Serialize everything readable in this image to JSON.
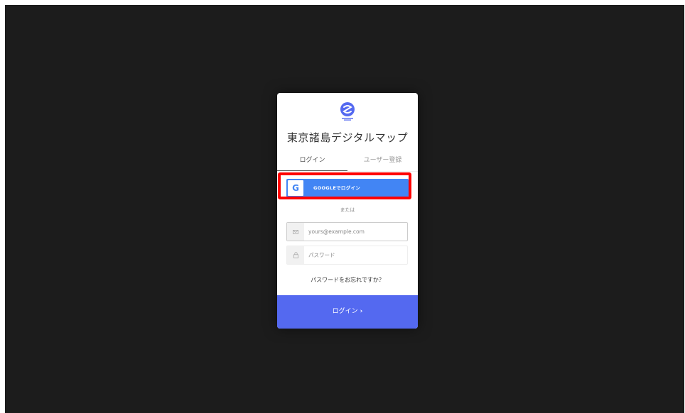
{
  "app": {
    "title": "東京諸島デジタルマップ",
    "accent_color": "#5469f0",
    "logo_icon": "s-wave-circle-icon"
  },
  "tabs": [
    {
      "label": "ログイン",
      "active": true
    },
    {
      "label": "ユーザー登録",
      "active": false
    }
  ],
  "google_button": {
    "icon": "google-g-icon",
    "icon_glyph": "G",
    "label": "GOOGLEでログイン",
    "color": "#4285f4",
    "highlight_color": "#ff0000"
  },
  "divider_text": "または",
  "email_field": {
    "icon": "envelope-icon",
    "placeholder": "yours@example.com",
    "value": ""
  },
  "password_field": {
    "icon": "lock-icon",
    "placeholder": "パスワード",
    "value": ""
  },
  "forgot_link": "パスワードをお忘れですか？",
  "submit_button": {
    "label": "ログイン",
    "icon": "chevron-right-icon",
    "icon_glyph": "›"
  }
}
